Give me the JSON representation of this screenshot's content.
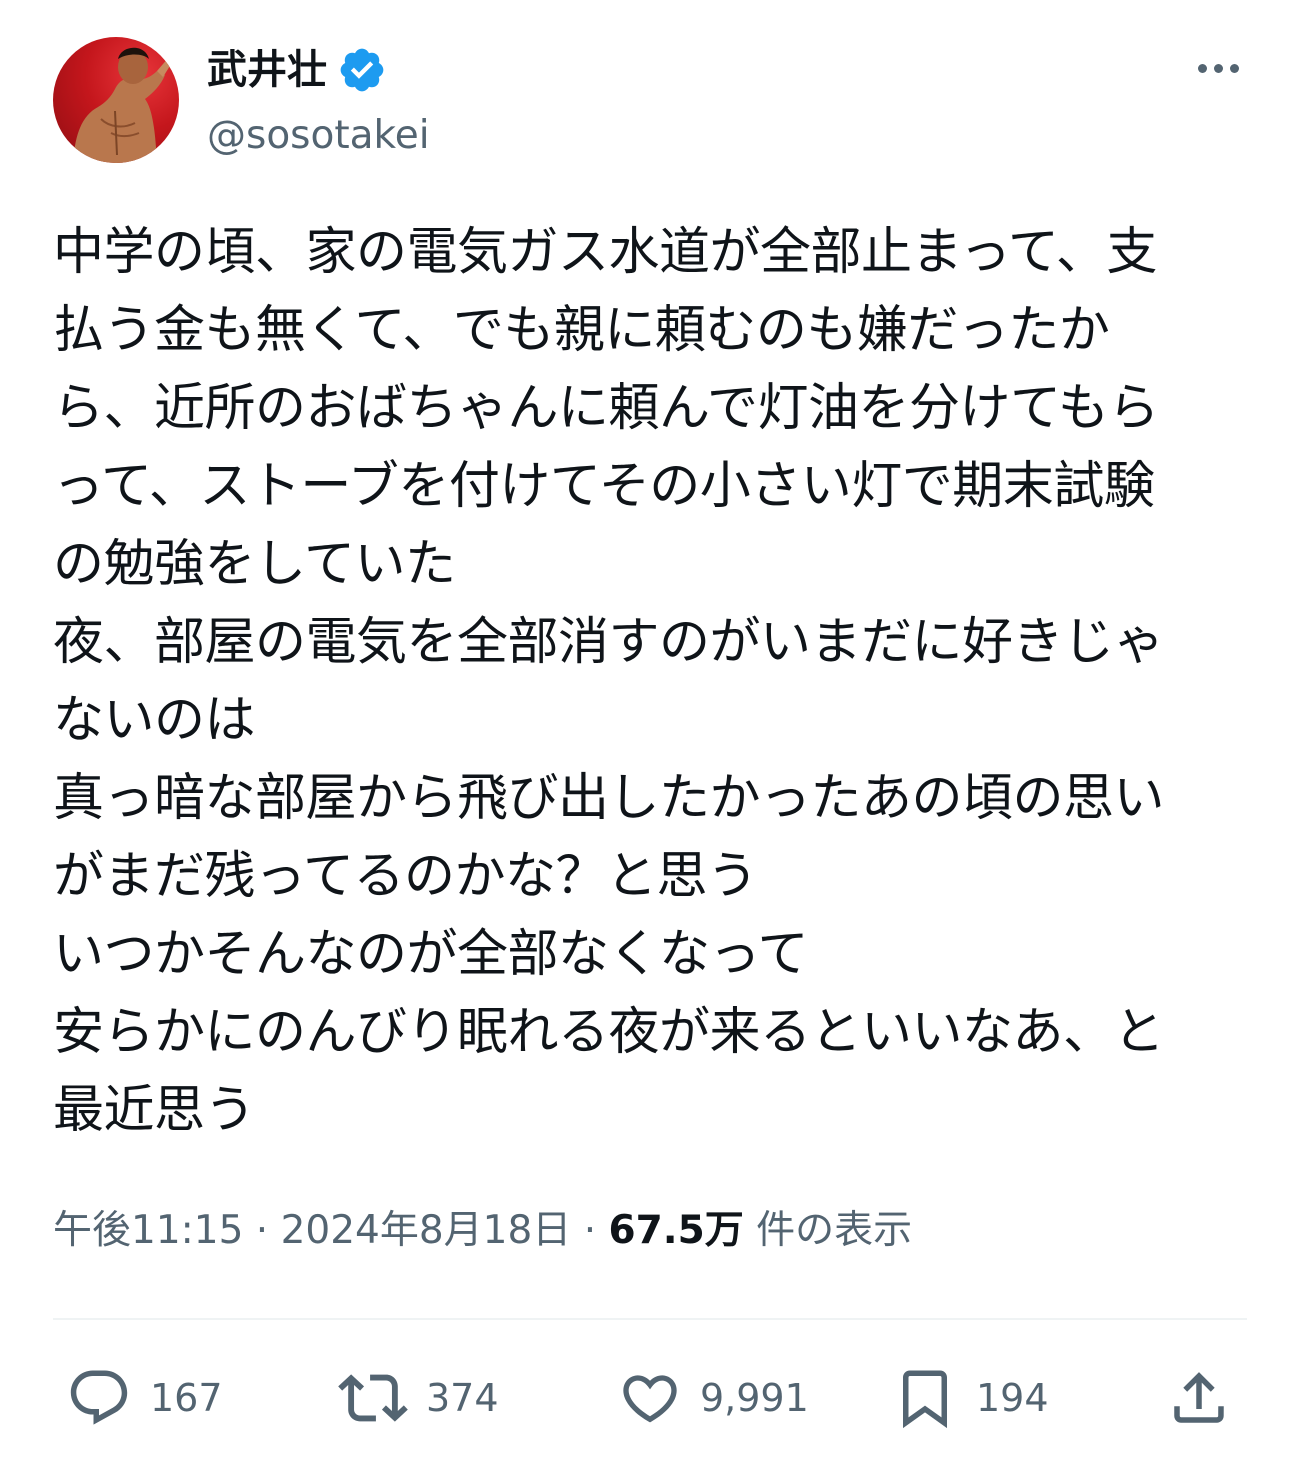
{
  "author": {
    "display_name": "武井壮",
    "handle": "@sosotakei",
    "verified_icon": "verified-badge-icon",
    "avatar_icon": "profile-photo"
  },
  "tweet": {
    "text": "中学の頃、家の電気ガス水道が全部止まって、支\n払う金も無くて、でも親に頼むのも嫌だったか\nら、近所のおばちゃんに頼んで灯油を分けてもら\nって、ストーブを付けてその小さい灯で期末試験\nの勉強をしていた\n夜、部屋の電気を全部消すのがいまだに好きじゃ\nないのは\n真っ暗な部屋から飛び出したかったあの頃の思い\nがまだ残ってるのかな？と思う\nいつかそんなのが全部なくなって\n安らかにのんびり眠れる夜が来るといいなあ、と\n最近思う",
    "time": "午後11:15",
    "separator": " · ",
    "date": "2024年8月18日",
    "views_count": "67.5万",
    "views_label": " 件の表示"
  },
  "actions": {
    "replies": "167",
    "reposts": "374",
    "likes": "9,991",
    "bookmarks": "194"
  },
  "colors": {
    "text": "#0f1419",
    "secondary": "#536471",
    "verified": "#1d9bf0",
    "divider": "#eff3f4"
  }
}
